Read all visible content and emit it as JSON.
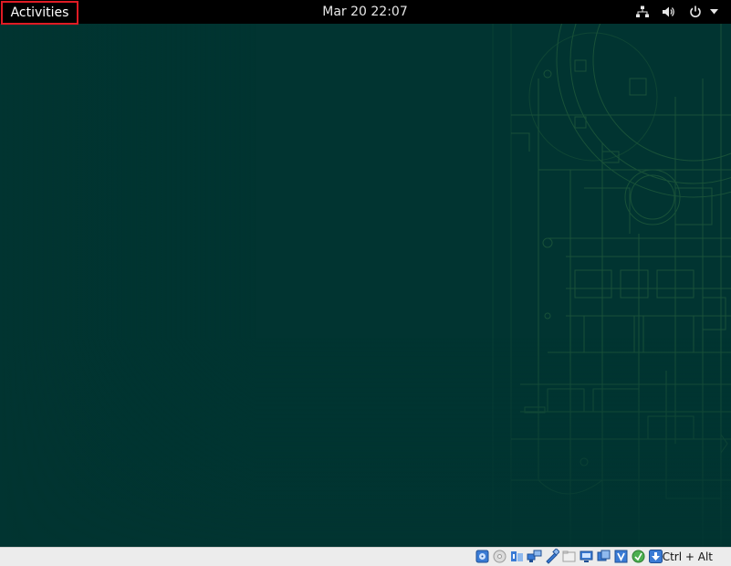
{
  "topbar": {
    "activities_label": "Activities",
    "clock": "Mar 20  22:07",
    "tray_icons": [
      "network-wired-icon",
      "volume-icon",
      "power-icon",
      "chevron-down-icon"
    ]
  },
  "desktop": {
    "wallpaper": "dark teal blueprint pattern",
    "background_color": "#013431",
    "pattern_color": "#2f6a3f"
  },
  "statusbar": {
    "icons": [
      "hard-disk-icon",
      "optical-drive-icon",
      "audio-icon",
      "network-icon",
      "usb-icon",
      "shared-folder-icon",
      "display-icon",
      "video-capture-icon",
      "virtualization-icon",
      "mouse-integration-icon",
      "host-key-arrow-icon"
    ],
    "host_key": "Ctrl + Alt"
  },
  "colors": {
    "topbar_bg": "#000000",
    "activities_border": "#e01b24",
    "statusbar_bg": "#ececec"
  }
}
